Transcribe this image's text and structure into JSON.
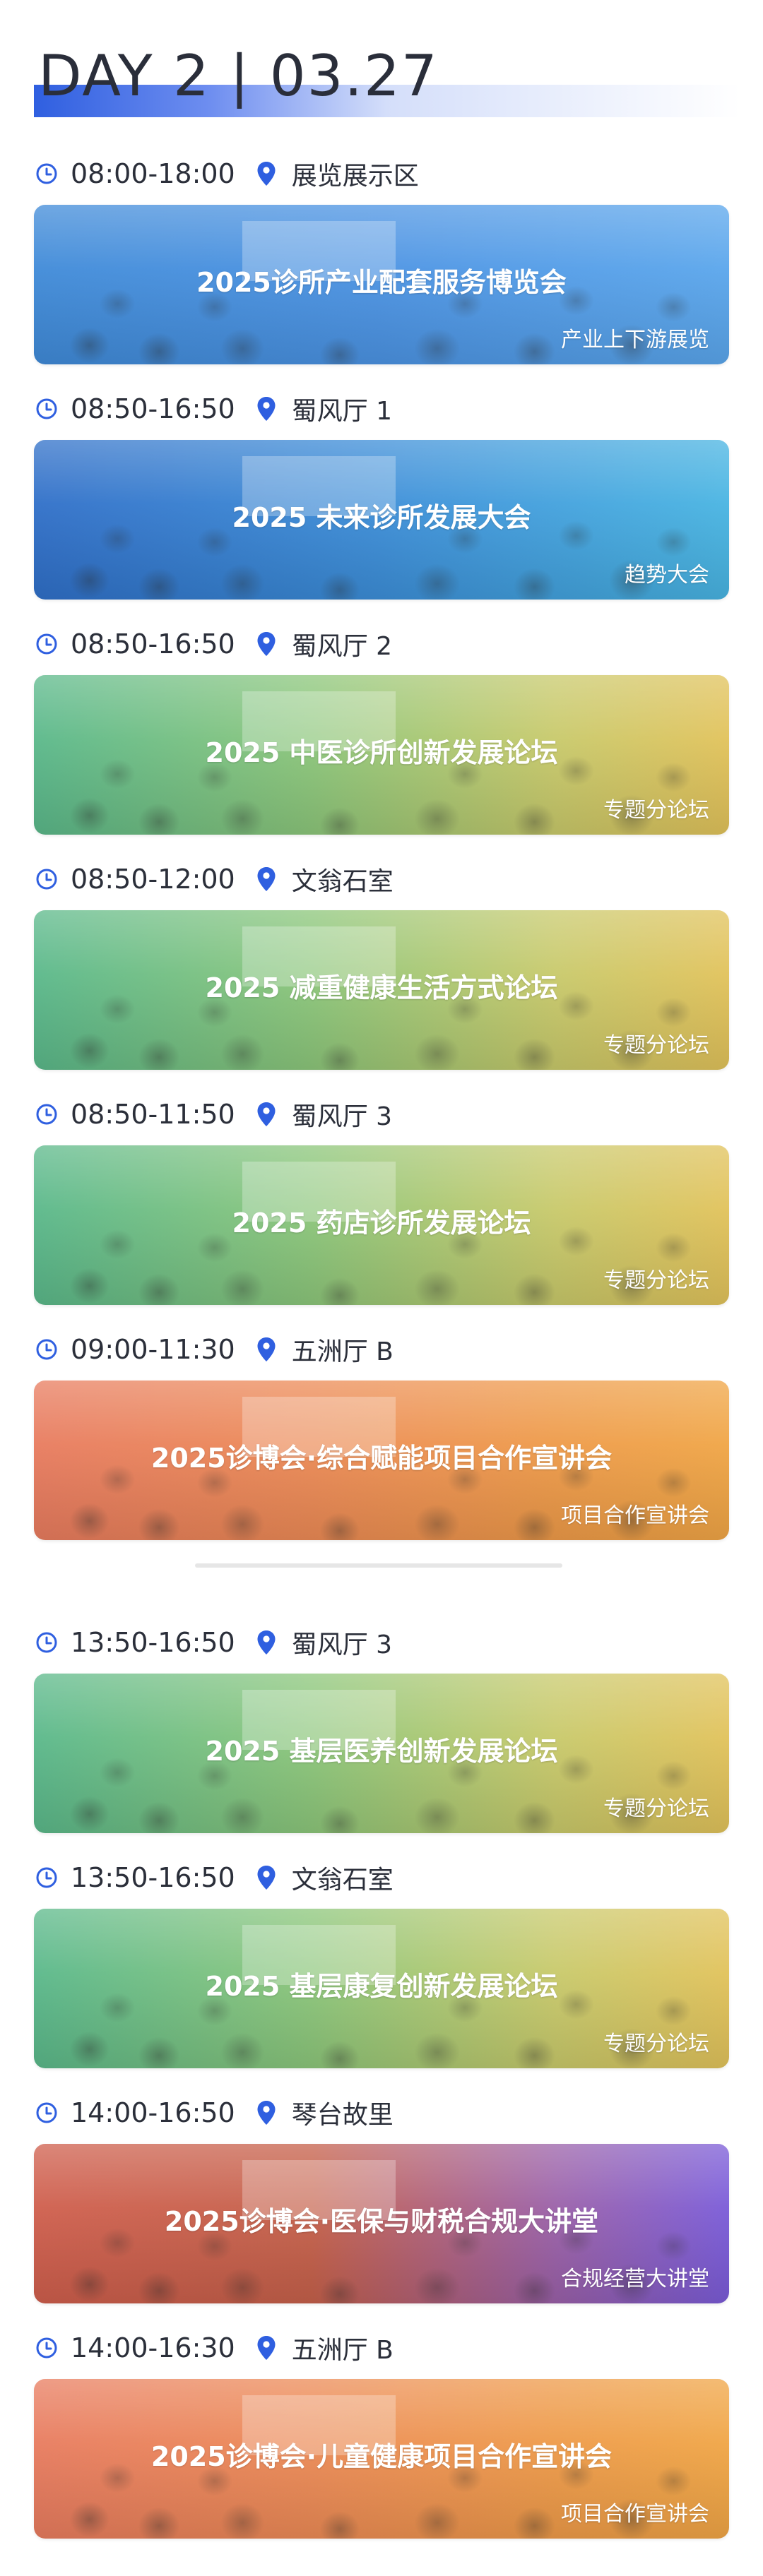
{
  "header": {
    "day_title": "DAY 2 | 03.27"
  },
  "colors": {
    "accent": "#2f5fe0",
    "text": "#2b2f3a"
  },
  "icons": {
    "time": "clock-icon",
    "location": "location-pin-icon"
  },
  "sessions_morning": [
    {
      "time": "08:00-18:00",
      "location": "展览展示区",
      "title": "2025诊所产业配套服务博览会",
      "tag": "产业上下游展览",
      "theme": "blue"
    },
    {
      "time": "08:50-16:50",
      "location": "蜀风厅 1",
      "title": "2025 未来诊所发展大会",
      "tag": "趋势大会",
      "theme": "teal"
    },
    {
      "time": "08:50-16:50",
      "location": "蜀风厅 2",
      "title": "2025 中医诊所创新发展论坛",
      "tag": "专题分论坛",
      "theme": "green"
    },
    {
      "time": "08:50-12:00",
      "location": "文翁石室",
      "title": "2025 减重健康生活方式论坛",
      "tag": "专题分论坛",
      "theme": "green"
    },
    {
      "time": "08:50-11:50",
      "location": "蜀风厅 3",
      "title": "2025 药店诊所发展论坛",
      "tag": "专题分论坛",
      "theme": "green"
    },
    {
      "time": "09:00-11:30",
      "location": "五洲厅 B",
      "title": "2025诊博会·综合赋能项目合作宣讲会",
      "tag": "项目合作宣讲会",
      "theme": "orange"
    }
  ],
  "sessions_afternoon": [
    {
      "time": "13:50-16:50",
      "location": "蜀风厅 3",
      "title": "2025 基层医养创新发展论坛",
      "tag": "专题分论坛",
      "theme": "green"
    },
    {
      "time": "13:50-16:50",
      "location": "文翁石室",
      "title": "2025 基层康复创新发展论坛",
      "tag": "专题分论坛",
      "theme": "green"
    },
    {
      "time": "14:00-16:50",
      "location": "琴台故里",
      "title": "2025诊博会·医保与财税合规大讲堂",
      "tag": "合规经营大讲堂",
      "theme": "purple"
    },
    {
      "time": "14:00-16:30",
      "location": "五洲厅 B",
      "title": "2025诊博会·儿童健康项目合作宣讲会",
      "tag": "项目合作宣讲会",
      "theme": "orange"
    }
  ]
}
